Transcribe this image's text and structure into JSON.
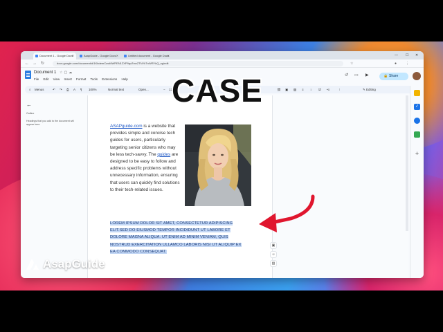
{
  "overlay": {
    "title": "CASE",
    "brand": "AsapGuide"
  },
  "browser": {
    "tabs": [
      {
        "label": "Document 1 - Google Docs",
        "color": "#4285f4"
      },
      {
        "label": "AsapGuide - Google Docs",
        "color": "#4285f4"
      },
      {
        "label": "Untitled document - Google Docs",
        "color": "#4285f4"
      }
    ],
    "url": "docs.google.com/document/d/1KbdemCuwMWPEN1ZXP9qzZmvZTNYkTnWRYkQ_ug/edit"
  },
  "doc": {
    "title": "Document 1",
    "menus": [
      "File",
      "Edit",
      "View",
      "Insert",
      "Format",
      "Tools",
      "Extensions",
      "Help"
    ],
    "share_label": "Share",
    "toolbar": {
      "search": "Menus",
      "zoom": "100%",
      "style": "Normal text",
      "font": "Open...",
      "size": "12",
      "mode": "Editing"
    },
    "outline": {
      "heading": "Outline",
      "hint": "Headings that you add to the document will appear here."
    },
    "body": {
      "link1": "ASAPguide.com",
      "text1": " is a website that provides simple and concise tech guides for users, particularly targeting senior citizens who may be less tech-savvy. The ",
      "link2": "guides",
      "text2": " are designed to  be easy to follow and address specific problems without  unnecessary information, ensuring that users can quickly find solutions to their tech-related issues."
    },
    "lorem": "LOREM IPSUM DOLOR SIT AMET, CONSECTETUR ADIPISCING ELIT.SED DO EIUSMOD TEMPOR INCIDIDUNT UT LABORE ET DOLORE MAGNA ALIQUA. UT ENIM AD MINIM VENIAM, QUIS NOSTRUD EXERCITATION ULLAMCO LABORIS NISI UT ALIQUIP EX EA COMMODO CONSEQUAT."
  },
  "colors": {
    "accent": "#1a73e8",
    "highlight": "#c3d7f5",
    "arrow": "#e0162e",
    "share": "#c2e7ff"
  },
  "icons": [
    "star-icon",
    "move-icon",
    "cloud-icon",
    "history-icon",
    "comment-icon",
    "meet-icon",
    "lock-icon",
    "back-icon",
    "add-comment-icon",
    "emoji-icon",
    "image-icon",
    "keep-icon",
    "tasks-icon",
    "contacts-icon",
    "maps-icon",
    "plus-icon"
  ]
}
